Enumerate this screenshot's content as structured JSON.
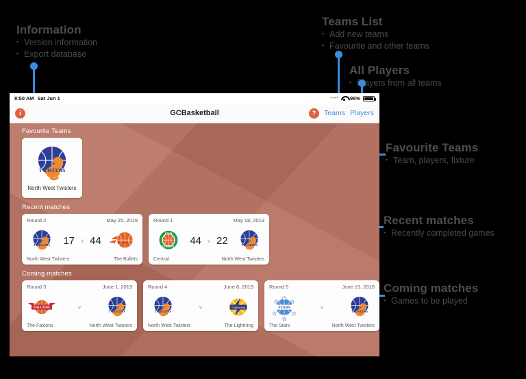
{
  "annotations": [
    {
      "id": "information",
      "title": "Information",
      "items": [
        "Version information",
        "Export database"
      ]
    },
    {
      "id": "teams-list",
      "title": "Teams List",
      "items": [
        "Add new teams",
        "Favourite and other teams"
      ]
    },
    {
      "id": "all-players",
      "title": "All Players",
      "items": [
        "Players from all teams"
      ]
    },
    {
      "id": "favourite-teams",
      "title": "Favourite Teams",
      "items": [
        "Team, players, fixture"
      ]
    },
    {
      "id": "recent-matches",
      "title": "Recent matches",
      "items": [
        "Recently completed games"
      ]
    },
    {
      "id": "coming-matches",
      "title": "Coming matches",
      "items": [
        "Games to be played"
      ]
    }
  ],
  "statusbar": {
    "time": "8:50 AM",
    "date": "Sat Jun 1",
    "battery": "98%"
  },
  "navbar": {
    "title": "GCBasketball",
    "info_icon": "info-icon",
    "help_icon": "help-icon",
    "teams_link": "Teams",
    "players_link": "Players"
  },
  "sections": {
    "favourite_teams": "Favourite Teams",
    "recent_matches": "Recent matches",
    "coming_matches": "Coming matches"
  },
  "favourite_team": {
    "name": "North West Twisters",
    "logo": "twisters-logo"
  },
  "recent_matches": [
    {
      "round": "Round 2",
      "date": "May 25, 2019",
      "home_team": "North West Twisters",
      "home_logo": "twisters-logo",
      "home_score": "17",
      "vs": "v",
      "away_team": "The Bullets",
      "away_logo": "bullets-logo",
      "away_score": "44"
    },
    {
      "round": "Round 1",
      "date": "May 18, 2019",
      "home_team": "Central",
      "home_logo": "central-logo",
      "home_score": "44",
      "vs": "v",
      "away_team": "North West Twisters",
      "away_logo": "twisters-logo",
      "away_score": "22"
    }
  ],
  "coming_matches": [
    {
      "round": "Round 3",
      "date": "June 1, 2019",
      "home_team": "The Falcons",
      "home_logo": "falcons-logo",
      "vs": "v",
      "away_team": "North West Twisters",
      "away_logo": "twisters-logo"
    },
    {
      "round": "Round 4",
      "date": "June 8, 2019",
      "home_team": "North West Twisters",
      "home_logo": "twisters-logo",
      "vs": "v",
      "away_team": "The Lightning",
      "away_logo": "lightning-logo"
    },
    {
      "round": "Round 5",
      "date": "June 15, 2019",
      "home_team": "The Stars",
      "home_logo": "stars-logo",
      "vs": "v",
      "away_team": "North West Twisters",
      "away_logo": "twisters-logo"
    }
  ],
  "colors": {
    "accent": "#dd6244",
    "background": "#b5705f",
    "link": "#4a8fd8",
    "annotation": "#4a4a4a",
    "leader": "#3d8ddd"
  }
}
